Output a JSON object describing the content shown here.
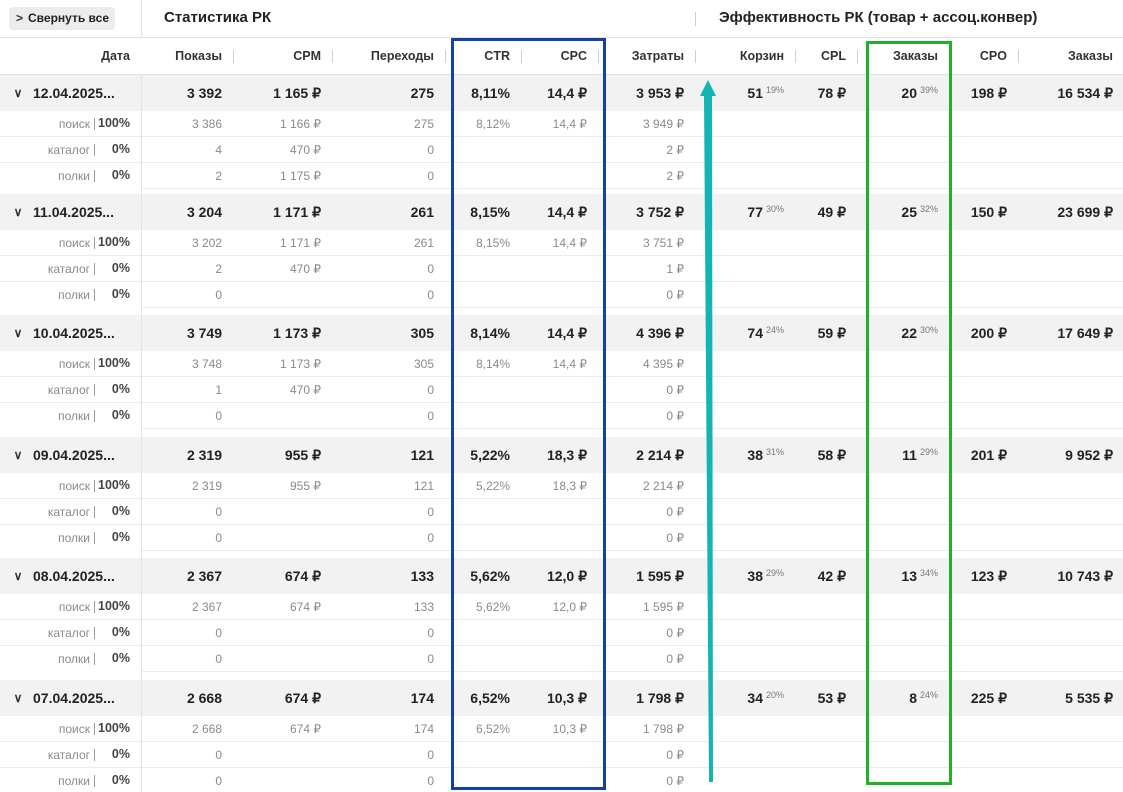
{
  "topbar": {
    "collapse_label": "Свернуть все",
    "section_stats": "Статистика РК",
    "section_efficiency": "Эффективность РК (товар + ассоц.конвер)"
  },
  "columns": [
    "Дата",
    "Показы",
    "CPM",
    "Переходы",
    "CTR",
    "CPC",
    "Затраты",
    "Корзин",
    "CPL",
    "Заказы",
    "CPO",
    "Заказы"
  ],
  "days": [
    {
      "date": "12.04.2025...",
      "impressions": "3 392",
      "cpm": "1 165 ₽",
      "clicks": "275",
      "ctr": "8,11%",
      "cpc": "14,4 ₽",
      "cost": "3 953 ₽",
      "carts": "51",
      "carts_pct": "19%",
      "cpl": "78 ₽",
      "orders": "20",
      "orders_pct": "39%",
      "cpo": "198 ₽",
      "orders_sum": "16 534 ₽",
      "sources": [
        {
          "name": "поиск",
          "share": "100%",
          "impressions": "3 386",
          "cpm": "1 166 ₽",
          "clicks": "275",
          "ctr": "8,12%",
          "cpc": "14,4 ₽",
          "cost": "3 949 ₽"
        },
        {
          "name": "каталог",
          "share": "0%",
          "impressions": "4",
          "cpm": "470 ₽",
          "clicks": "0",
          "ctr": "",
          "cpc": "",
          "cost": "2 ₽"
        },
        {
          "name": "полки",
          "share": "0%",
          "impressions": "2",
          "cpm": "1 175 ₽",
          "clicks": "0",
          "ctr": "",
          "cpc": "",
          "cost": "2 ₽"
        }
      ]
    },
    {
      "date": "11.04.2025...",
      "impressions": "3 204",
      "cpm": "1 171 ₽",
      "clicks": "261",
      "ctr": "8,15%",
      "cpc": "14,4 ₽",
      "cost": "3 752 ₽",
      "carts": "77",
      "carts_pct": "30%",
      "cpl": "49 ₽",
      "orders": "25",
      "orders_pct": "32%",
      "cpo": "150 ₽",
      "orders_sum": "23 699 ₽",
      "sources": [
        {
          "name": "поиск",
          "share": "100%",
          "impressions": "3 202",
          "cpm": "1 171 ₽",
          "clicks": "261",
          "ctr": "8,15%",
          "cpc": "14,4 ₽",
          "cost": "3 751 ₽"
        },
        {
          "name": "каталог",
          "share": "0%",
          "impressions": "2",
          "cpm": "470 ₽",
          "clicks": "0",
          "ctr": "",
          "cpc": "",
          "cost": "1 ₽"
        },
        {
          "name": "полки",
          "share": "0%",
          "impressions": "0",
          "cpm": "",
          "clicks": "0",
          "ctr": "",
          "cpc": "",
          "cost": "0 ₽"
        }
      ]
    },
    {
      "date": "10.04.2025...",
      "impressions": "3 749",
      "cpm": "1 173 ₽",
      "clicks": "305",
      "ctr": "8,14%",
      "cpc": "14,4 ₽",
      "cost": "4 396 ₽",
      "carts": "74",
      "carts_pct": "24%",
      "cpl": "59 ₽",
      "orders": "22",
      "orders_pct": "30%",
      "cpo": "200 ₽",
      "orders_sum": "17 649 ₽",
      "sources": [
        {
          "name": "поиск",
          "share": "100%",
          "impressions": "3 748",
          "cpm": "1 173 ₽",
          "clicks": "305",
          "ctr": "8,14%",
          "cpc": "14,4 ₽",
          "cost": "4 395 ₽"
        },
        {
          "name": "каталог",
          "share": "0%",
          "impressions": "1",
          "cpm": "470 ₽",
          "clicks": "0",
          "ctr": "",
          "cpc": "",
          "cost": "0 ₽"
        },
        {
          "name": "полки",
          "share": "0%",
          "impressions": "0",
          "cpm": "",
          "clicks": "0",
          "ctr": "",
          "cpc": "",
          "cost": "0 ₽"
        }
      ]
    },
    {
      "date": "09.04.2025...",
      "impressions": "2 319",
      "cpm": "955 ₽",
      "clicks": "121",
      "ctr": "5,22%",
      "cpc": "18,3 ₽",
      "cost": "2 214 ₽",
      "carts": "38",
      "carts_pct": "31%",
      "cpl": "58 ₽",
      "orders": "11",
      "orders_pct": "29%",
      "cpo": "201 ₽",
      "orders_sum": "9 952 ₽",
      "sources": [
        {
          "name": "поиск",
          "share": "100%",
          "impressions": "2 319",
          "cpm": "955 ₽",
          "clicks": "121",
          "ctr": "5,22%",
          "cpc": "18,3 ₽",
          "cost": "2 214 ₽"
        },
        {
          "name": "каталог",
          "share": "0%",
          "impressions": "0",
          "cpm": "",
          "clicks": "0",
          "ctr": "",
          "cpc": "",
          "cost": "0 ₽"
        },
        {
          "name": "полки",
          "share": "0%",
          "impressions": "0",
          "cpm": "",
          "clicks": "0",
          "ctr": "",
          "cpc": "",
          "cost": "0 ₽"
        }
      ]
    },
    {
      "date": "08.04.2025...",
      "impressions": "2 367",
      "cpm": "674 ₽",
      "clicks": "133",
      "ctr": "5,62%",
      "cpc": "12,0 ₽",
      "cost": "1 595 ₽",
      "carts": "38",
      "carts_pct": "29%",
      "cpl": "42 ₽",
      "orders": "13",
      "orders_pct": "34%",
      "cpo": "123 ₽",
      "orders_sum": "10 743 ₽",
      "sources": [
        {
          "name": "поиск",
          "share": "100%",
          "impressions": "2 367",
          "cpm": "674 ₽",
          "clicks": "133",
          "ctr": "5,62%",
          "cpc": "12,0 ₽",
          "cost": "1 595 ₽"
        },
        {
          "name": "каталог",
          "share": "0%",
          "impressions": "0",
          "cpm": "",
          "clicks": "0",
          "ctr": "",
          "cpc": "",
          "cost": "0 ₽"
        },
        {
          "name": "полки",
          "share": "0%",
          "impressions": "0",
          "cpm": "",
          "clicks": "0",
          "ctr": "",
          "cpc": "",
          "cost": "0 ₽"
        }
      ]
    },
    {
      "date": "07.04.2025...",
      "impressions": "2 668",
      "cpm": "674 ₽",
      "clicks": "174",
      "ctr": "6,52%",
      "cpc": "10,3 ₽",
      "cost": "1 798 ₽",
      "carts": "34",
      "carts_pct": "20%",
      "cpl": "53 ₽",
      "orders": "8",
      "orders_pct": "24%",
      "cpo": "225 ₽",
      "orders_sum": "5 535 ₽",
      "sources": [
        {
          "name": "поиск",
          "share": "100%",
          "impressions": "2 668",
          "cpm": "674 ₽",
          "clicks": "174",
          "ctr": "6,52%",
          "cpc": "10,3 ₽",
          "cost": "1 798 ₽"
        },
        {
          "name": "каталог",
          "share": "0%",
          "impressions": "0",
          "cpm": "",
          "clicks": "0",
          "ctr": "",
          "cpc": "",
          "cost": "0 ₽"
        },
        {
          "name": "полки",
          "share": "0%",
          "impressions": "0",
          "cpm": "",
          "clicks": "0",
          "ctr": "",
          "cpc": "",
          "cost": "0 ₽"
        }
      ]
    }
  ],
  "annotations": {
    "blue_box_color": "#1440a8",
    "green_box_color": "#22b02a",
    "arrow_color": "#14b4b4"
  }
}
